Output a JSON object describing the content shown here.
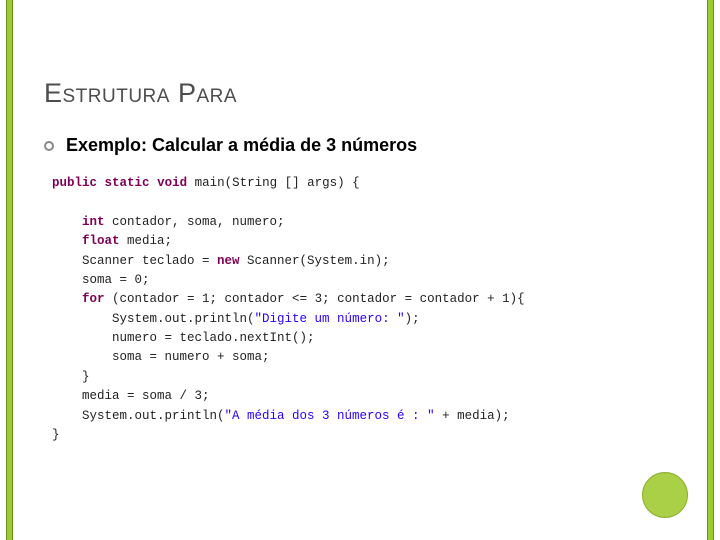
{
  "title": "Estrutura Para",
  "subtitle": "Exemplo: Calcular a média de 3 números",
  "code": {
    "l1a": "public",
    "l1b": "static",
    "l1c": "void",
    "l1d": " main(String [] args) {",
    "blank": "",
    "l2a": "int",
    "l2b": " contador, soma, numero;",
    "l3a": "float",
    "l3b": " media;",
    "l4a": "    Scanner teclado = ",
    "l4b": "new",
    "l4c": " Scanner(System.in);",
    "l5": "    soma = 0;",
    "l6a": "for",
    "l6b": " (contador = 1; contador <= 3; contador = contador + 1){",
    "l7a": "        System.out.println(",
    "l7b": "\"Digite um número: \"",
    "l7c": ");",
    "l8": "        numero = teclado.nextInt();",
    "l9": "        soma = numero + soma;",
    "l10": "    }",
    "l11": "    media = soma / 3;",
    "l12a": "    System.out.println(",
    "l12b": "\"A média dos 3 números é : \"",
    "l12c": " + media);",
    "l13": "}"
  }
}
